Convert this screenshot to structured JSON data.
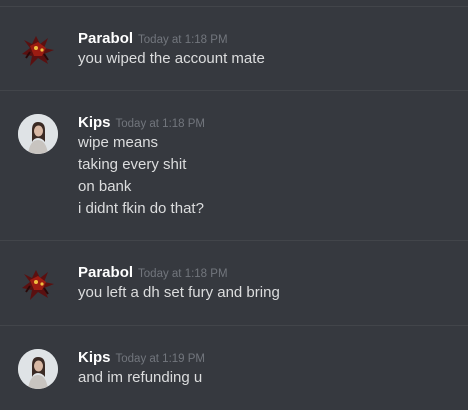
{
  "messages": [
    {
      "author": "Parabol",
      "timestamp": "Today at 1:18 PM",
      "avatar_icon": "demon-avatar-icon",
      "lines": [
        "you wiped the account mate"
      ]
    },
    {
      "author": "Kips",
      "timestamp": "Today at 1:18 PM",
      "avatar_icon": "user-photo-avatar",
      "lines": [
        "wipe means",
        "taking every shit",
        "on bank",
        "i didnt fkin do that?"
      ]
    },
    {
      "author": "Parabol",
      "timestamp": "Today at 1:18 PM",
      "avatar_icon": "demon-avatar-icon",
      "lines": [
        "you left a dh set fury and bring"
      ]
    },
    {
      "author": "Kips",
      "timestamp": "Today at 1:19 PM",
      "avatar_icon": "user-photo-avatar",
      "lines": [
        "and im refunding u"
      ]
    }
  ],
  "colors": {
    "background": "#36393f",
    "author": "#ffffff",
    "timestamp": "#72767d",
    "text": "#dcddde",
    "divider": "#42454a"
  }
}
